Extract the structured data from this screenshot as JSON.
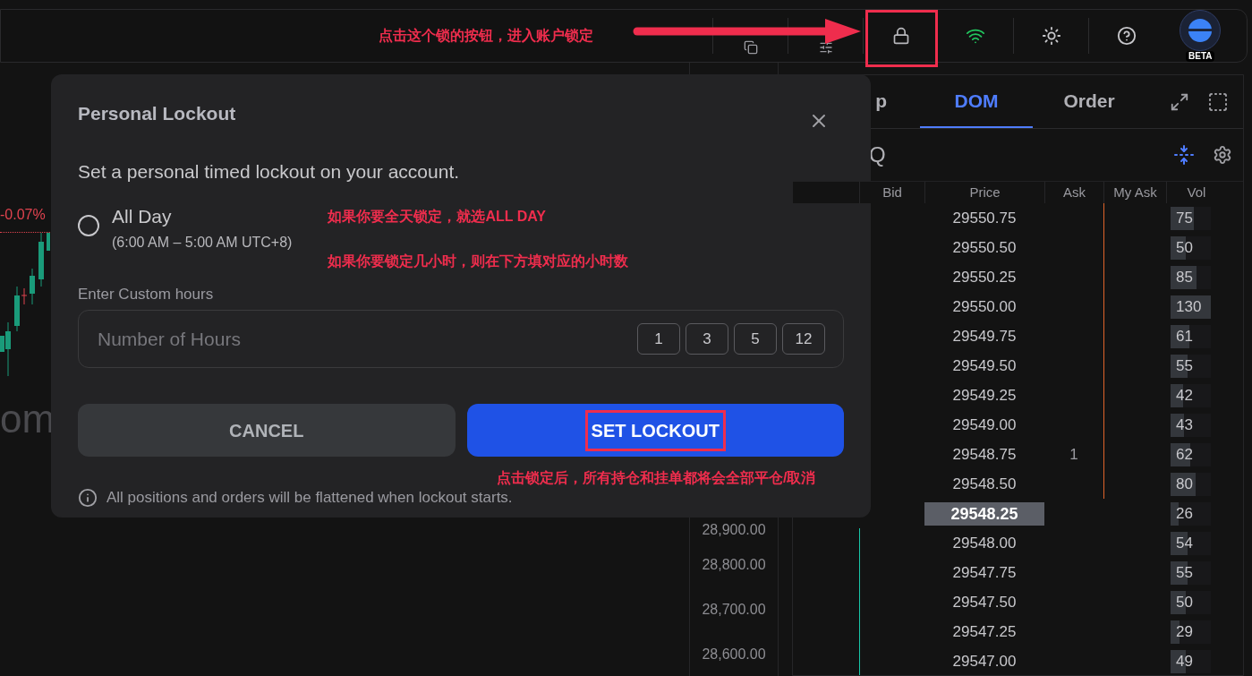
{
  "annotations": {
    "lock_hint": "点击这个锁的按钮，进入账户锁定",
    "all_day_hint": "如果你要全天锁定，就选ALL DAY",
    "hours_hint": "如果你要锁定几小时，则在下方填对应的小时数",
    "flatten_hint": "点击锁定后，所有持仓和挂单都将会全部平仓/取消"
  },
  "header": {
    "avatar_badge": "BETA"
  },
  "chart": {
    "change": "-0.07%",
    "watermark": "om",
    "axis_labels": [
      "28,900.00",
      "28,800.00",
      "28,700.00",
      "28,600.00"
    ]
  },
  "dom_panel": {
    "tabs": [
      {
        "label": "p",
        "selected": false
      },
      {
        "label": "DOM",
        "selected": true
      },
      {
        "label": "Order",
        "selected": false
      }
    ],
    "symbol": "Q",
    "columns": [
      "Bid",
      "Price",
      "Ask",
      "My Ask",
      "Vol"
    ],
    "rows": [
      {
        "price": "29550.75",
        "vol": "75",
        "level": 0.58,
        "selected": false
      },
      {
        "price": "29550.50",
        "vol": "50",
        "level": 0.38,
        "selected": false
      },
      {
        "price": "29550.25",
        "vol": "85",
        "level": 0.65,
        "selected": false
      },
      {
        "price": "29550.00",
        "vol": "130",
        "level": 1,
        "selected": false
      },
      {
        "price": "29549.75",
        "vol": "61",
        "level": 0.47,
        "selected": false
      },
      {
        "price": "29549.50",
        "vol": "55",
        "level": 0.42,
        "selected": false
      },
      {
        "price": "29549.25",
        "vol": "42",
        "level": 0.32,
        "selected": false
      },
      {
        "price": "29549.00",
        "vol": "43",
        "level": 0.33,
        "selected": false
      },
      {
        "price": "29548.75",
        "ask": "1",
        "vol": "62",
        "level": 0.48,
        "selected": false
      },
      {
        "price": "29548.50",
        "vol": "80",
        "level": 0.62,
        "selected": false
      },
      {
        "price": "29548.25",
        "vol": "26",
        "level": 0.2,
        "selected": true
      },
      {
        "price": "29548.00",
        "vol": "54",
        "level": 0.42,
        "selected": false
      },
      {
        "price": "29547.75",
        "vol": "55",
        "level": 0.42,
        "selected": false
      },
      {
        "price": "29547.50",
        "vol": "50",
        "level": 0.38,
        "selected": false
      },
      {
        "price": "29547.25",
        "vol": "29",
        "level": 0.22,
        "selected": false
      },
      {
        "price": "29547.00",
        "vol": "49",
        "level": 0.38,
        "selected": false
      }
    ]
  },
  "dialog": {
    "title": "Personal Lockout",
    "description": "Set a personal timed lockout on your account.",
    "all_day": {
      "label": "All Day",
      "hours": "(6:00 AM – 5:00 AM UTC+8)",
      "selected": false
    },
    "custom_label": "Enter Custom hours",
    "custom_placeholder": "Number of Hours",
    "presets": [
      "1",
      "3",
      "5",
      "12"
    ],
    "cancel": "CANCEL",
    "confirm": "SET LOCKOUT",
    "note": "All positions and orders will be flattened when lockout starts."
  }
}
